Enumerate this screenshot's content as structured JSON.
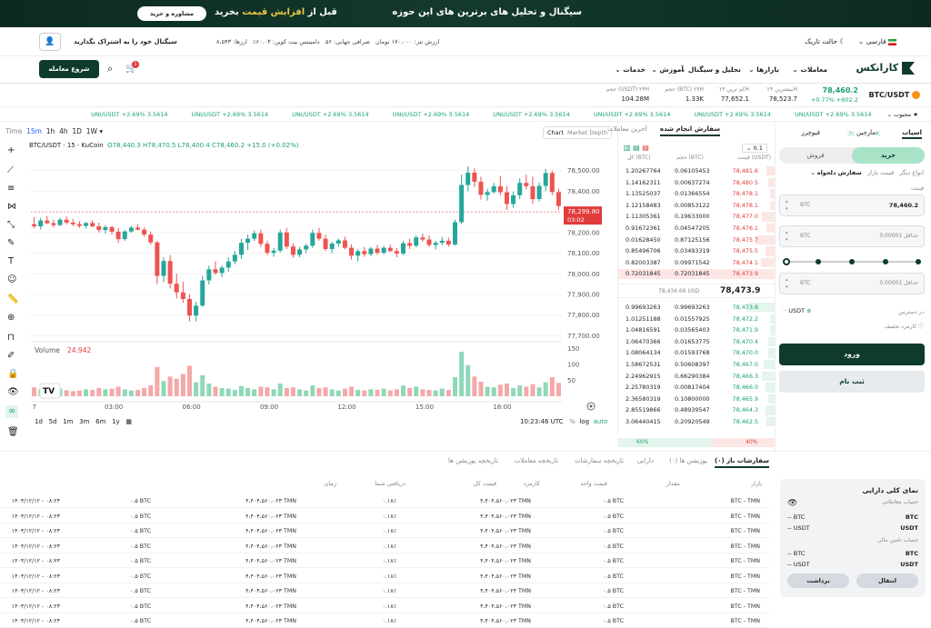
{
  "banner": {
    "headline": "سیگنال و تحلیل های برترین های این حوزه",
    "sub_prefix": "قبل از ",
    "sub_highlight": "افزایش قیمت",
    "sub_suffix": " بخرید",
    "button": "مشاوره و خرید"
  },
  "topbar": {
    "lang": "فارسی",
    "theme": "حالت تاریک",
    "profile_prompt": "سیگنال خود را به اشتراک بگذارید",
    "info": [
      "ارزها: ۸،۵۴۳",
      "دامیننس بیت کوین: ۶۰.۰۳٪",
      "صرافی جهانی: ۵۶",
      "ارزش تتر: ۱۷۰،۰۰۰ تومان"
    ]
  },
  "nav": {
    "brand": "کارانکس",
    "items": [
      "معاملات",
      "بازارها",
      "تحلیل و سیگنال",
      "آموزش",
      "خدمات"
    ],
    "start_button": "شروع معامله",
    "cart_badge": "1"
  },
  "stats": {
    "pair": "BTC/USDT",
    "price": "78,460.2",
    "change": "+0.77% +602.2",
    "cols": [
      {
        "label": "بیشترین ۲۴H",
        "value": "78,523.7"
      },
      {
        "label": "کم ترین ۲۴H",
        "value": "77,652.1"
      },
      {
        "label": "حجم (BTC) ۲۴H",
        "value": "1.33K"
      },
      {
        "label": "حجم (USDT) ۲۴H",
        "value": "104.28M"
      }
    ]
  },
  "ticker": {
    "fav": "محبوب",
    "items": [
      "UNI/USDT +2.69% 3.5614",
      "UNI/USDT +2.69% 3.5614",
      "UNI/USDT +2.69% 3.5614",
      "UNI/USDT +2.69% 3.5614",
      "UNI/USDT +2.69% 3.5614",
      "UNI/USDT +2.69% 3.5614",
      "UNI/USDT +2.69% 3.5614",
      "UNI/USDT +2.69% 3.5614"
    ]
  },
  "chart": {
    "intervals": [
      "Time",
      "15m",
      "1h",
      "4h",
      "1D",
      "1W"
    ],
    "active_interval": "15m",
    "view_tabs": [
      "Chart",
      "Market Depth"
    ],
    "legend": "BTC/USDT · 15 · KuCoin",
    "ohlc": "O78,440.3  H78,470.5  L78,400.4  C78,460.2  +15.0 (+0.02%)",
    "price_tag": "78,299.80",
    "countdown": "03:02",
    "volume_label": "Volume",
    "volume_value": "24.942",
    "ranges": [
      "1d",
      "5d",
      "1m",
      "3m",
      "6m",
      "1y"
    ],
    "clock": "10:23:46 UTC",
    "log": "log",
    "auto": "auto",
    "watermark": "TV"
  },
  "chart_data": {
    "type": "candlestick",
    "title": "BTC/USDT · 15 · KuCoin",
    "x_ticks": [
      "7",
      "03:00",
      "06:00",
      "09:00",
      "12:00",
      "15:00",
      "18:00"
    ],
    "y_ticks": [
      "78,500.00",
      "78,400.00",
      "78,300.00",
      "78,200.00",
      "78,100.00",
      "78,000.00",
      "77,900.00",
      "77,800.00",
      "77,700.00"
    ],
    "ylim": [
      77680,
      78560
    ],
    "volume_ticks": [
      "150",
      "100",
      "50"
    ],
    "volume_ylim": [
      0,
      160
    ],
    "candles": [
      [
        78240,
        78275,
        78220,
        78230
      ],
      [
        78230,
        78270,
        78215,
        78258
      ],
      [
        78258,
        78280,
        78240,
        78245
      ],
      [
        78245,
        78262,
        78225,
        78236
      ],
      [
        78236,
        78270,
        78230,
        78262
      ],
      [
        78262,
        78278,
        78240,
        78248
      ],
      [
        78248,
        78265,
        78230,
        78240
      ],
      [
        78240,
        78255,
        78222,
        78232
      ],
      [
        78232,
        78250,
        78220,
        78246
      ],
      [
        78246,
        78260,
        78225,
        78230
      ],
      [
        78230,
        78248,
        78200,
        78212
      ],
      [
        78212,
        78235,
        78195,
        78226
      ],
      [
        78226,
        78232,
        78190,
        78204
      ],
      [
        78204,
        78222,
        78150,
        78168
      ],
      [
        78168,
        78212,
        78160,
        78205
      ],
      [
        78205,
        78232,
        78198,
        78224
      ],
      [
        78224,
        78240,
        78210,
        78214
      ],
      [
        78214,
        78225,
        78180,
        78190
      ],
      [
        78190,
        78205,
        78140,
        78152
      ],
      [
        78152,
        78160,
        77950,
        77990
      ],
      [
        77990,
        78080,
        77960,
        78062
      ],
      [
        78062,
        78090,
        77930,
        77952
      ],
      [
        77952,
        78000,
        77880,
        77910
      ],
      [
        77910,
        77962,
        77860,
        77878
      ],
      [
        77878,
        77900,
        77770,
        77798
      ],
      [
        77798,
        77865,
        77770,
        77846
      ],
      [
        77846,
        77990,
        77840,
        77968
      ],
      [
        77968,
        78040,
        77948,
        78022
      ],
      [
        78022,
        78060,
        77995,
        78004
      ],
      [
        78004,
        78040,
        77985,
        78030
      ],
      [
        78030,
        78080,
        78010,
        78060
      ],
      [
        78060,
        78110,
        78046,
        78092
      ],
      [
        78092,
        78170,
        78072,
        78150
      ],
      [
        78150,
        78190,
        78115,
        78170
      ],
      [
        78170,
        78210,
        78160,
        78196
      ],
      [
        78196,
        78214,
        78130,
        78145
      ],
      [
        78145,
        78160,
        78090,
        78102
      ],
      [
        78102,
        78125,
        78082,
        78112
      ],
      [
        78112,
        78215,
        78104,
        78200
      ],
      [
        78200,
        78222,
        78120,
        78132
      ],
      [
        78132,
        78148,
        78078,
        78092
      ],
      [
        78092,
        78130,
        78080,
        78118
      ],
      [
        78118,
        78145,
        78100,
        78136
      ],
      [
        78136,
        78214,
        78126,
        78198
      ],
      [
        78198,
        78222,
        78160,
        78170
      ],
      [
        78170,
        78190,
        78110,
        78120
      ],
      [
        78120,
        78155,
        78100,
        78146
      ],
      [
        78146,
        78170,
        78130,
        78162
      ],
      [
        78162,
        78180,
        78118,
        78126
      ],
      [
        78126,
        78142,
        78070,
        78088
      ],
      [
        78088,
        78120,
        78060,
        78110
      ],
      [
        78110,
        78130,
        78082,
        78095
      ],
      [
        78095,
        78130,
        78085,
        78122
      ],
      [
        78122,
        78140,
        78092,
        78102
      ],
      [
        78102,
        78135,
        78094,
        78126
      ],
      [
        78126,
        78142,
        78104,
        78110
      ],
      [
        78110,
        78125,
        78080,
        78098
      ],
      [
        78098,
        78160,
        78090,
        78148
      ],
      [
        78148,
        78170,
        78120,
        78136
      ],
      [
        78136,
        78185,
        78128,
        78176
      ],
      [
        78176,
        78195,
        78155,
        78166
      ],
      [
        78166,
        78185,
        78130,
        78140
      ],
      [
        78140,
        78160,
        78118,
        78150
      ],
      [
        78150,
        78178,
        78138,
        78160
      ],
      [
        78160,
        78175,
        78132,
        78142
      ],
      [
        78142,
        78262,
        78136,
        78250
      ],
      [
        78250,
        78480,
        78240,
        78430
      ],
      [
        78430,
        78520,
        78400,
        78490
      ],
      [
        78490,
        78510,
        78420,
        78446
      ],
      [
        78446,
        78470,
        78360,
        78382
      ],
      [
        78382,
        78412,
        78354,
        78396
      ],
      [
        78396,
        78440,
        78388,
        78424
      ],
      [
        78424,
        78474,
        78380,
        78395
      ],
      [
        78395,
        78425,
        78310,
        78338
      ],
      [
        78338,
        78398,
        78320,
        78380
      ],
      [
        78380,
        78462,
        78362,
        78440
      ],
      [
        78440,
        78480,
        78408,
        78424
      ],
      [
        78424,
        78470,
        78340,
        78362
      ],
      [
        78362,
        78442,
        78350,
        78426
      ],
      [
        78426,
        78508,
        78400,
        78488
      ],
      [
        78488,
        78500,
        78380,
        78396
      ],
      [
        78396,
        78412,
        78310,
        78328
      ]
    ],
    "volume": [
      28,
      22,
      18,
      20,
      24,
      19,
      16,
      18,
      22,
      20,
      26,
      22,
      24,
      30,
      22,
      18,
      20,
      26,
      34,
      92,
      48,
      62,
      55,
      70,
      96,
      44,
      66,
      40,
      30,
      26,
      24,
      20,
      32,
      26,
      22,
      30,
      28,
      22,
      40,
      26,
      28,
      22,
      18,
      34,
      26,
      28,
      22,
      18,
      24,
      30,
      20,
      18,
      22,
      20,
      24,
      18,
      22,
      34,
      26,
      30,
      22,
      20,
      18,
      24,
      20,
      60,
      140,
      98,
      62,
      46,
      30,
      28,
      36,
      40,
      26,
      34,
      30,
      38,
      28,
      44,
      60,
      42
    ]
  },
  "book": {
    "tabs": [
      "سفارش انجام شده",
      "آخرین معاملات"
    ],
    "precision": "0.1",
    "headers": [
      "قیمت (USDT)",
      "حجم (BTC)",
      "کل (BTC)"
    ],
    "asks": [
      [
        "78,481.6",
        "0.06105453",
        "1.20267764",
        5
      ],
      [
        "78,480.5",
        "0.00637274",
        "1.14162311",
        4
      ],
      [
        "78,478.1",
        "0.01366554",
        "1.13525037",
        3
      ],
      [
        "78,478.1",
        "0.00853122",
        "1.12158483",
        3
      ],
      [
        "78,477.0",
        "0.19633000",
        "1.11305361",
        8
      ],
      [
        "78,476.1",
        "0.04547205",
        "0.91672361",
        5
      ],
      [
        "78,475.7",
        "0.87125156",
        "0.01628450",
        12
      ],
      [
        "78,475.5",
        "0.03493319",
        "0.85496706",
        6
      ],
      [
        "78,474.1",
        "0.09971542",
        "0.82003387",
        9
      ],
      [
        "78,473.9",
        "0.72031845",
        "0.72031845",
        100
      ]
    ],
    "mid_usd": "78,434.66 USD",
    "mid_price": "78,473.9",
    "bids": [
      [
        "78,473.8",
        "0.99693263",
        "0.99693263",
        18
      ],
      [
        "78,472.2",
        "0.01557925",
        "1.01251188",
        3
      ],
      [
        "78,471.9",
        "0.03565403",
        "1.04816591",
        3
      ],
      [
        "78,470.4",
        "0.01653775",
        "1.06470366",
        4
      ],
      [
        "78,470.0",
        "0.01593768",
        "1.08064134",
        4
      ],
      [
        "78,467.0",
        "0.50608397",
        "1.58672531",
        7
      ],
      [
        "78,466.3",
        "0.66290384",
        "2.24962915",
        8
      ],
      [
        "78,466.0",
        "0.00817404",
        "2.25780319",
        6
      ],
      [
        "78,465.9",
        "0.10800000",
        "2.36580319",
        4
      ],
      [
        "78,464.3",
        "0.48939547",
        "2.85519866",
        6
      ],
      [
        "78,462.5",
        "0.20920549",
        "3.06440415",
        5
      ]
    ],
    "ratio_buy": "60%",
    "ratio_sell": "40%"
  },
  "trade": {
    "tabs": [
      "اسپات",
      "مارجین",
      "فیوچرز"
    ],
    "margin_badge": "۱۰x",
    "buy": "خرید",
    "sell": "فروش",
    "order_types": [
      "سفارش دلخواه",
      "قیمت بازار",
      "انواع دیگر"
    ],
    "price_label": "قیمت",
    "price_value": "78,460.2",
    "coin": "BTC",
    "min_label": "حداقل",
    "min_value": "0.00001",
    "max_label": "حداقل",
    "max_value": "0.00001",
    "usdt_label": "USDT",
    "avail_label": "در دسترس",
    "fee_label": "کارمزد تخفیف",
    "login": "ورود",
    "register": "ثبت نام"
  },
  "bottom": {
    "tabs": [
      "سفارشات باز (۰)",
      "پوزیشن ها (۰)",
      "دارایی",
      "تاریخچه سفارشات",
      "تاریخچه معاملات",
      "تاریخچه پوزیشن ها"
    ],
    "headers": [
      "بازار",
      "مقدار",
      "قیمت واحد",
      "کارمزد",
      "قیمت کل",
      "دریافتی شما",
      "زمان"
    ],
    "row": [
      "BTC - TMN",
      "۰.۵ BTC",
      "۴،۴۰۴،۵۶۰،۰۲۳ TMN",
      "۰.۱۸٪",
      "۴،۴۰۴،۵۶۰،۰۲۳ TMN",
      "۰.۵ BTC",
      "۱۴۰۳/۱۲/۱۲ - ۰۸:۲۳"
    ],
    "row_count": 9,
    "asset": {
      "title": "نمای کلی دارایی",
      "trade_acc": "حساب معاملاتی",
      "fund_acc": "حساب تامین مالی",
      "btc": "BTC",
      "usdt": "USDT",
      "dash": "--",
      "transfer": "انتقال",
      "withdraw": "برداشت"
    }
  },
  "colors": {
    "green": "#1aa36f",
    "red": "#e23b3b",
    "dark": "#0f3b2e"
  }
}
